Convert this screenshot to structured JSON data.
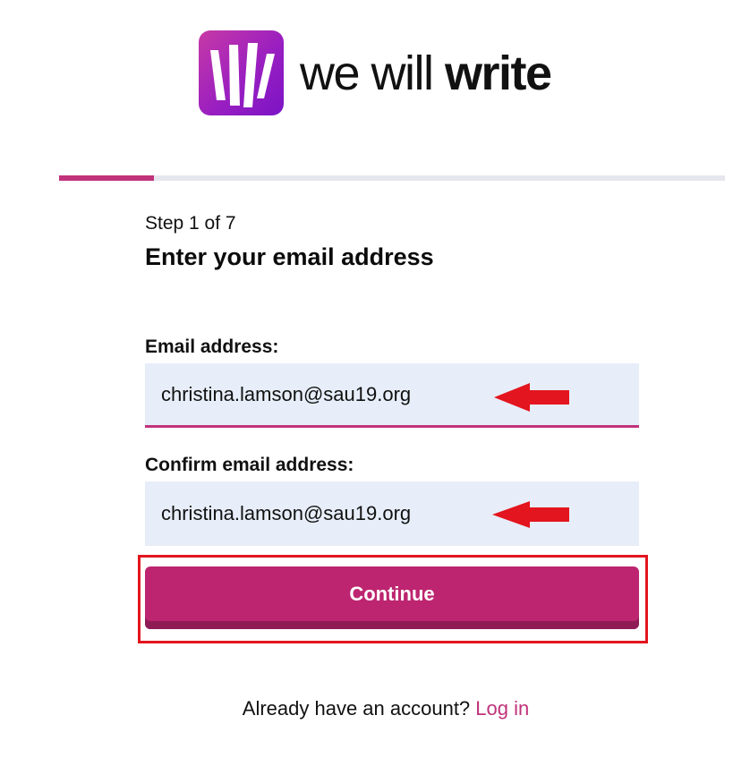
{
  "brand": {
    "name_light": "we will ",
    "name_bold": "write",
    "logo_icon": "wwr-hand-logo-icon"
  },
  "progress": {
    "current_step": 1,
    "total_steps": 7,
    "fraction": 0.143
  },
  "step_text": "Step 1 of 7",
  "heading": "Enter your email address",
  "email": {
    "label": "Email address:",
    "value": "christina.lamson@sau19.org"
  },
  "confirm": {
    "label": "Confirm email address:",
    "value": "christina.lamson@sau19.org"
  },
  "continue_label": "Continue",
  "footer": {
    "prompt": "Already have an account? ",
    "login_link": "Log in"
  },
  "colors": {
    "accent": "#c0327a",
    "button": "#bd2570",
    "field_bg": "#e7eef9",
    "annotation_red": "#e3151e"
  }
}
